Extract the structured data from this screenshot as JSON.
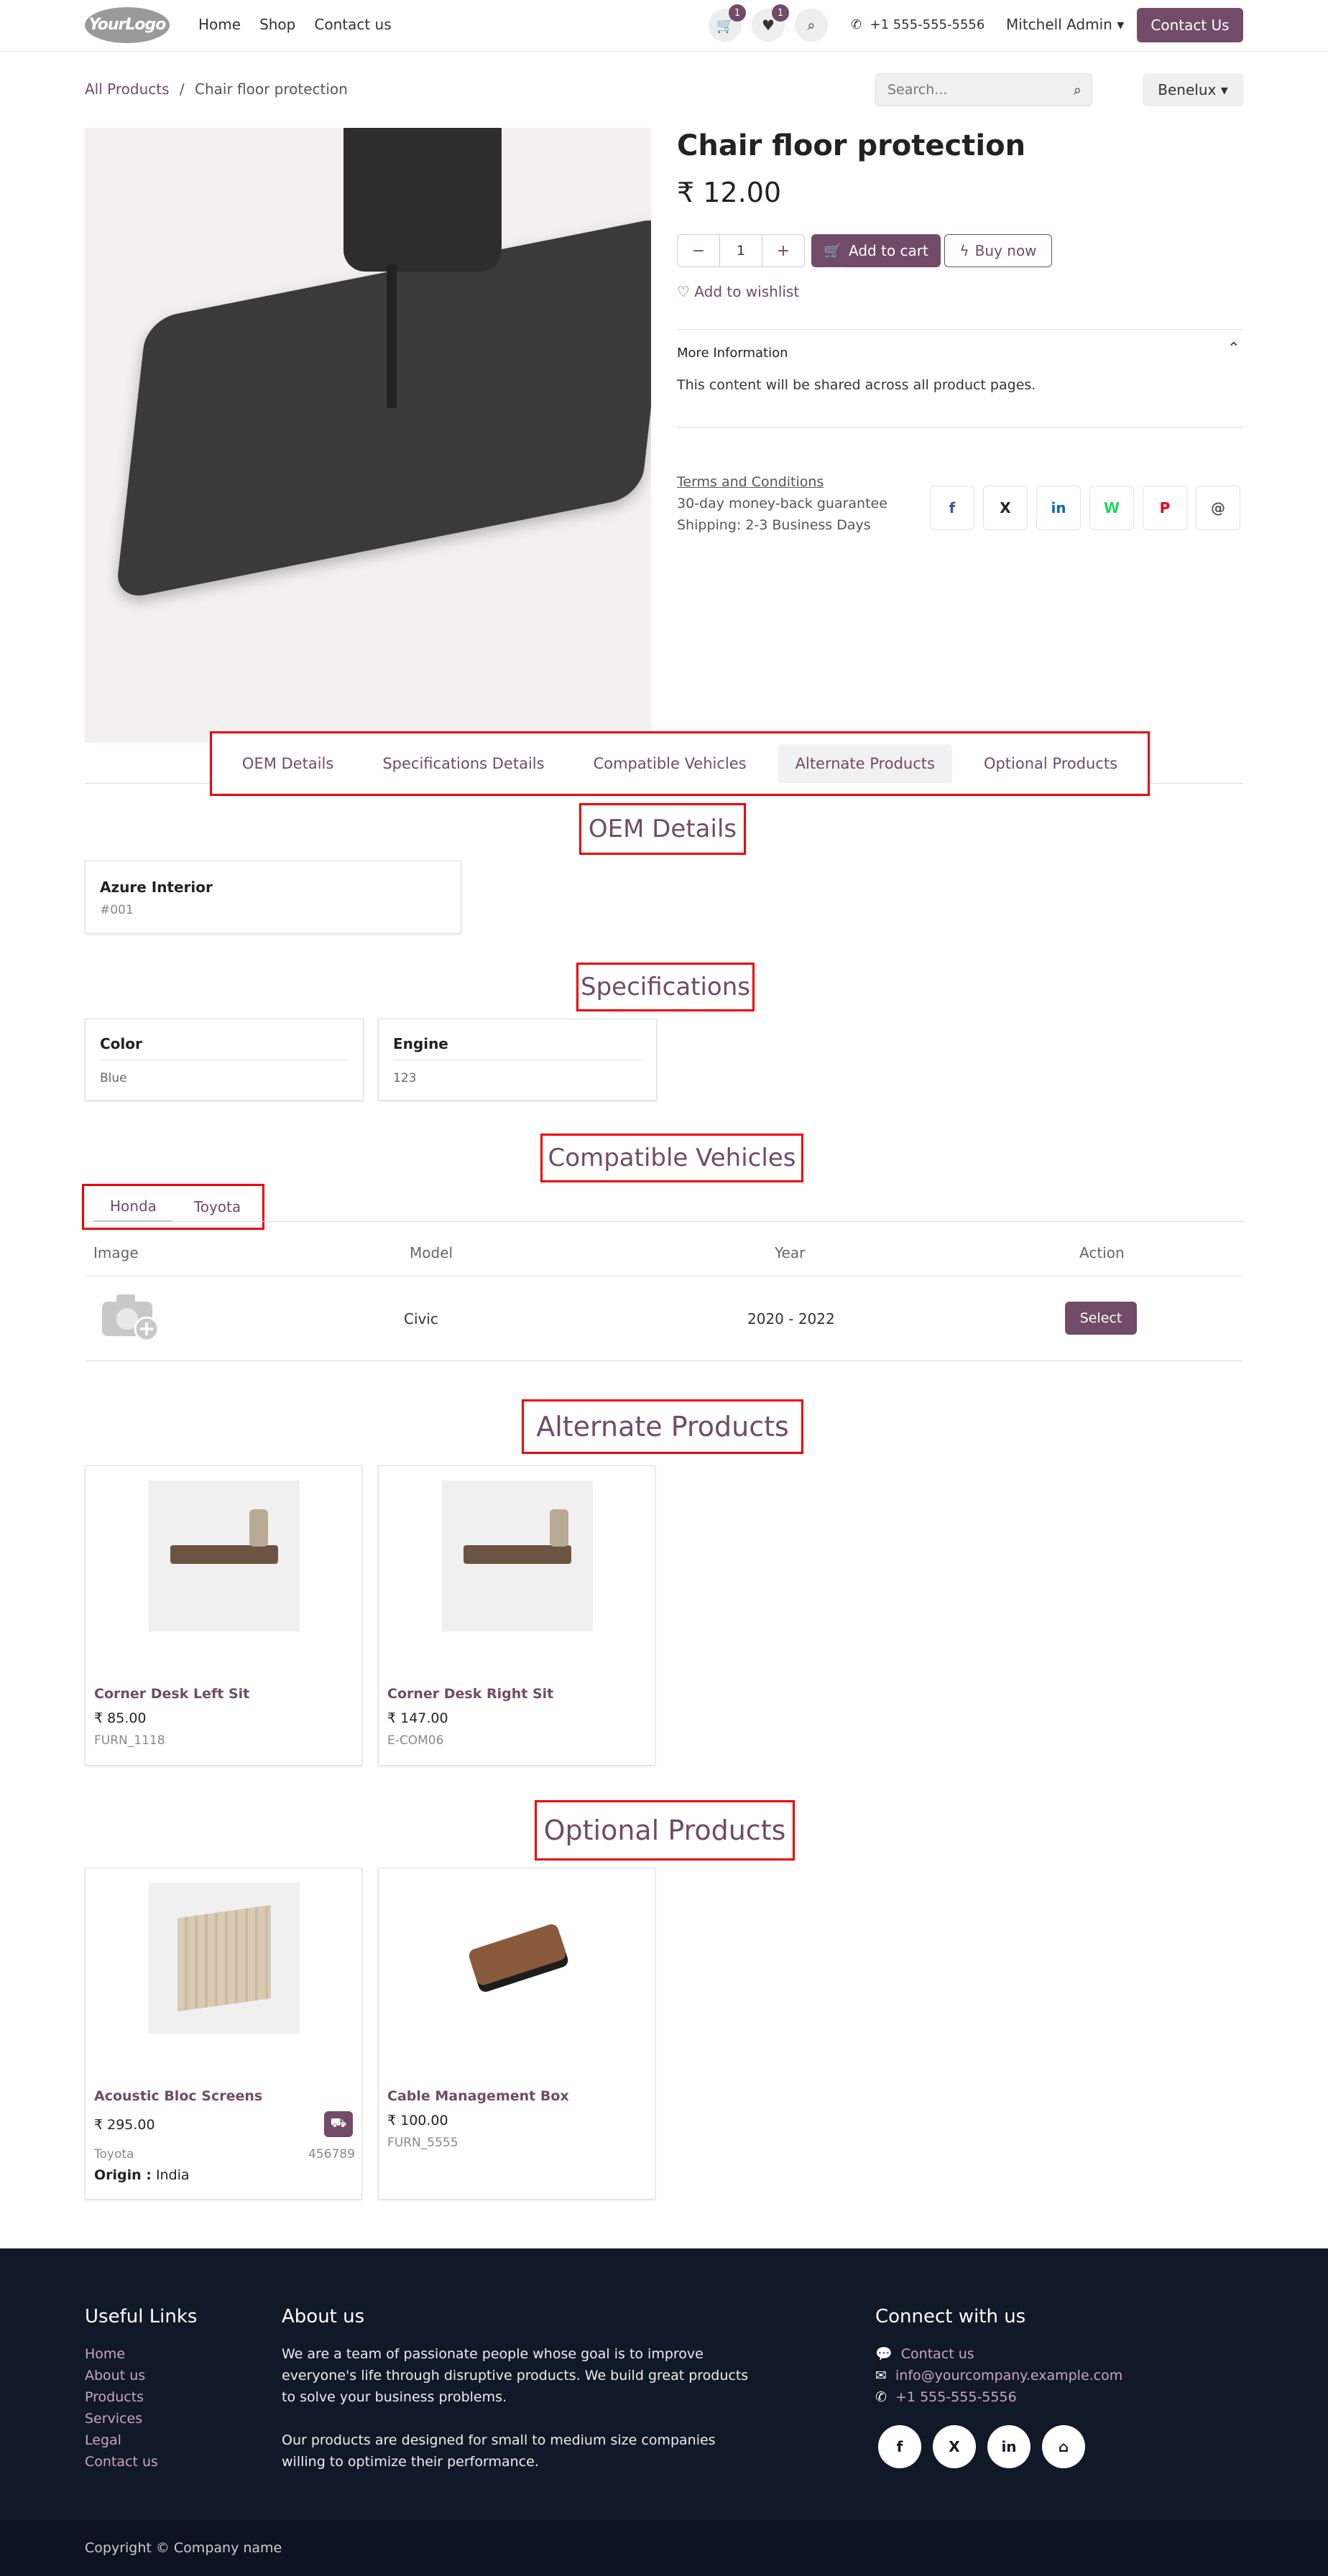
{
  "header": {
    "logo_text": "YourLogo",
    "nav": [
      "Home",
      "Shop",
      "Contact us"
    ],
    "cart_count": "1",
    "wishlist_count": "1",
    "phone": "+1 555-555-5556",
    "user": "Mitchell Admin",
    "contact_button": "Contact Us"
  },
  "breadcrumb": {
    "root": "All Products",
    "separator": "/",
    "current": "Chair floor protection"
  },
  "search": {
    "placeholder": "Search..."
  },
  "pricelist": "Benelux",
  "product": {
    "name": "Chair floor protection",
    "price": "₹ 12.00",
    "quantity": "1",
    "add_to_cart": "Add to cart",
    "buy_now": "Buy now",
    "wishlist": "Add to wishlist",
    "more_info_title": "More Information",
    "more_info_body": "This content will be shared across all product pages.",
    "terms": "Terms and Conditions",
    "guarantee": "30-day money-back guarantee",
    "shipping": "Shipping: 2-3 Business Days"
  },
  "share_icons": [
    "f",
    "X",
    "in",
    "W",
    "P",
    "@"
  ],
  "tabs": [
    "OEM Details",
    "Specifications Details",
    "Compatible Vehicles",
    "Alternate Products",
    "Optional Products"
  ],
  "oem": {
    "title": "OEM Details",
    "name": "Azure Interior",
    "ref": "#001"
  },
  "specs": {
    "title": "Specifications",
    "items": [
      {
        "label": "Color",
        "value": "Blue"
      },
      {
        "label": "Engine",
        "value": "123"
      }
    ]
  },
  "vehicles": {
    "title": "Compatible Vehicles",
    "brands": [
      "Honda",
      "Toyota"
    ],
    "columns": [
      "Image",
      "Model",
      "Year",
      "Action"
    ],
    "rows": [
      {
        "model": "Civic",
        "year": "2020 - 2022",
        "action": "Select"
      }
    ]
  },
  "alternate": {
    "title": "Alternate Products",
    "items": [
      {
        "name": "Corner Desk Left Sit",
        "price": "₹ 85.00",
        "ref": "FURN_1118"
      },
      {
        "name": "Corner Desk Right Sit",
        "price": "₹ 147.00",
        "ref": "E-COM06"
      }
    ]
  },
  "optional": {
    "title": "Optional Products",
    "items": [
      {
        "name": "Acoustic Bloc Screens",
        "price": "₹ 295.00",
        "brand": "Toyota",
        "ref": "456789",
        "origin_label": "Origin :",
        "origin": "India"
      },
      {
        "name": "Cable Management Box",
        "price": "₹ 100.00",
        "ref": "FURN_5555"
      }
    ]
  },
  "footer": {
    "useful_title": "Useful Links",
    "links": [
      "Home",
      "About us",
      "Products",
      "Services",
      "Legal",
      "Contact us"
    ],
    "about_title": "About us",
    "about_p1": "We are a team of passionate people whose goal is to improve everyone's life through disruptive products. We build great products to solve your business problems.",
    "about_p2": "Our products are designed for small to medium size companies willing to optimize their performance.",
    "connect_title": "Connect with us",
    "contact": "Contact us",
    "email": "info@yourcompany.example.com",
    "phone": "+1 555-555-5556",
    "social": [
      "f",
      "X",
      "in",
      "⌂"
    ],
    "copyright": "Copyright © Company name"
  }
}
